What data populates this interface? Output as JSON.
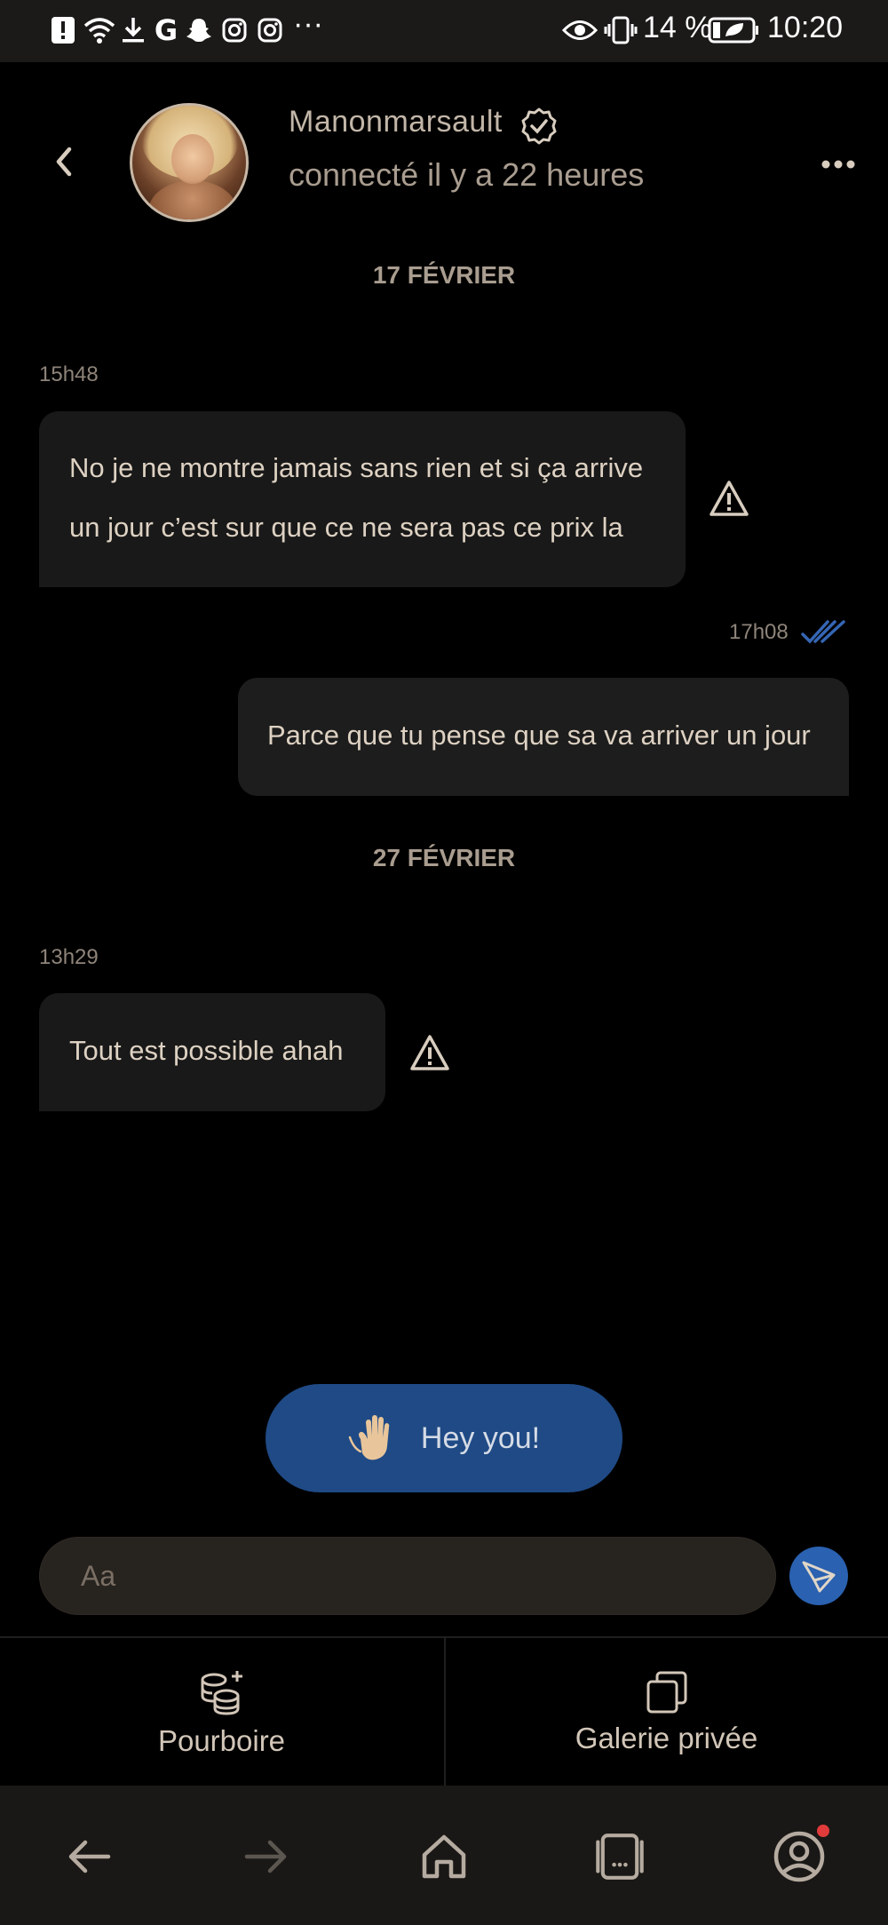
{
  "status_bar": {
    "battery_percent": "14 %",
    "time": "10:20",
    "more_indicator": "···"
  },
  "header": {
    "username": "Manonmarsault",
    "last_seen": "connecté il y a 22 heures"
  },
  "conversation": {
    "date_separators": [
      "17 FÉVRIER",
      "27 FÉVRIER"
    ],
    "messages": [
      {
        "direction": "in",
        "time": "15h48",
        "lines": [
          "No je ne montre jamais sans rien et si ça arrive",
          "un jour c’est sur que ce ne sera pas ce prix la"
        ],
        "warning": true
      },
      {
        "direction": "out",
        "time": "17h08",
        "text": "Parce que tu pense que sa va arriver un jour",
        "read": true
      },
      {
        "direction": "in",
        "time": "13h29",
        "text": "Tout est possible ahah",
        "warning": true
      }
    ]
  },
  "quick_reply": {
    "label": "Hey you!"
  },
  "composer": {
    "placeholder": "Aa"
  },
  "actions": {
    "tip_label": "Pourboire",
    "gallery_label": "Galerie privée"
  },
  "colors": {
    "background": "#000000",
    "bubble": "#191919",
    "accent_blue": "#2a61b0",
    "text": "#ddd1c2"
  }
}
